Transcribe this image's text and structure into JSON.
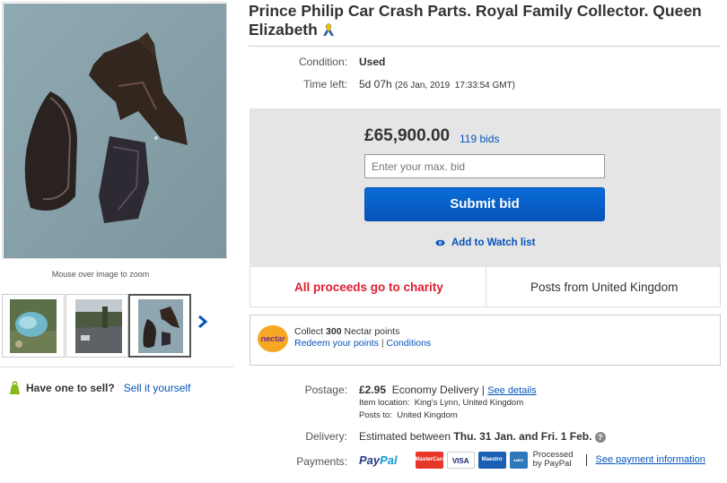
{
  "gallery": {
    "zoom_hint": "Mouse over image to zoom",
    "thumbnails": [
      {
        "name": "thumb-car-wreck-grass"
      },
      {
        "name": "thumb-road-scene"
      },
      {
        "name": "thumb-car-parts"
      }
    ]
  },
  "sell": {
    "question": "Have one to sell?",
    "link": "Sell it yourself"
  },
  "listing": {
    "title": "Prince Philip Car Crash Parts. Royal Family Collector. Queen Elizabeth",
    "condition_label": "Condition:",
    "condition_value": "Used",
    "time_left_label": "Time left:",
    "time_left_value": "5d 07h",
    "time_left_detail": "(26 Jan, 2019  17:33:54 GMT)"
  },
  "bid": {
    "price": "£65,900.00",
    "bids": "119 bids",
    "input_placeholder": "Enter your max. bid",
    "submit_label": "Submit bid",
    "watch_label": "Add to Watch list"
  },
  "info": {
    "charity": "All proceeds go to charity",
    "posts_from": "Posts from United Kingdom"
  },
  "nectar": {
    "logo_text": "nectar",
    "collect_prefix": "Collect",
    "points": "300",
    "collect_suffix": "Nectar points",
    "redeem_link": "Redeem your points",
    "separator": "|",
    "conditions_link": "Conditions"
  },
  "postage": {
    "label": "Postage:",
    "price": "£2.95",
    "method": "Economy Delivery",
    "separator": "|",
    "details_link": "See details",
    "item_location": "Item location:  King's Lynn, United Kingdom",
    "posts_to": "Posts to:  United Kingdom"
  },
  "delivery": {
    "label": "Delivery:",
    "prefix": "Estimated between",
    "range": "Thu. 31 Jan. and Fri. 1 Feb."
  },
  "payments": {
    "label": "Payments:",
    "paypal_a": "Pay",
    "paypal_b": "Pal",
    "cards": [
      "MasterCard",
      "VISA",
      "Maestro",
      "AMEX"
    ],
    "processed_line1": "Processed",
    "processed_line2": "by PayPal",
    "info_link": "See payment information"
  },
  "colors": {
    "link": "#0654ba",
    "charity_red": "#dd1e31",
    "bid_panel": "#e5e5e5",
    "button_blue": "#0654ba",
    "nectar_orange": "#f7a823"
  }
}
